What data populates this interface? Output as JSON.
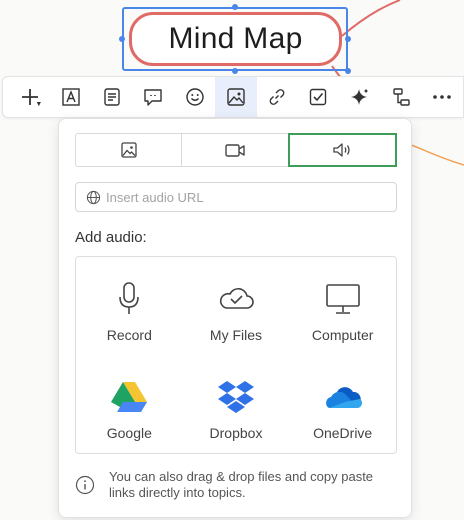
{
  "topic": {
    "title": "Mind Map"
  },
  "toolbar": {
    "items": [
      {
        "name": "add-topic",
        "icon": "plus-icon",
        "dropdown": true
      },
      {
        "name": "text-box",
        "icon": "text-box-icon"
      },
      {
        "name": "note",
        "icon": "note-icon"
      },
      {
        "name": "comment",
        "icon": "comment-icon"
      },
      {
        "name": "emoji",
        "icon": "smiley-icon"
      },
      {
        "name": "media",
        "icon": "image-icon",
        "active": true
      },
      {
        "name": "link",
        "icon": "link-icon"
      },
      {
        "name": "task",
        "icon": "checkbox-icon"
      },
      {
        "name": "ai",
        "icon": "sparkle-icon"
      },
      {
        "name": "structure",
        "icon": "structure-icon"
      },
      {
        "name": "more",
        "icon": "more-icon"
      }
    ]
  },
  "media_panel": {
    "tabs": [
      {
        "name": "image",
        "icon": "image-icon"
      },
      {
        "name": "video",
        "icon": "video-icon"
      },
      {
        "name": "audio",
        "icon": "speaker-icon",
        "selected": true
      }
    ],
    "url_placeholder": "Insert audio URL",
    "url_value": "",
    "add_label": "Add audio:",
    "sources": [
      {
        "label": "Record",
        "icon": "microphone-icon"
      },
      {
        "label": "My Files",
        "icon": "cloud-check-icon"
      },
      {
        "label": "Computer",
        "icon": "monitor-icon"
      },
      {
        "label": "Google",
        "icon": "google-drive-icon"
      },
      {
        "label": "Dropbox",
        "icon": "dropbox-icon"
      },
      {
        "label": "OneDrive",
        "icon": "onedrive-icon"
      }
    ],
    "hint": "You can also drag & drop files and copy paste links directly into topics."
  },
  "colors": {
    "topic_border": "#e06a66",
    "selection": "#4a86e8",
    "branch_orange": "#f2a35a",
    "selected_tab": "#3f9d5a",
    "active_tool_bg": "#e8eefb"
  }
}
